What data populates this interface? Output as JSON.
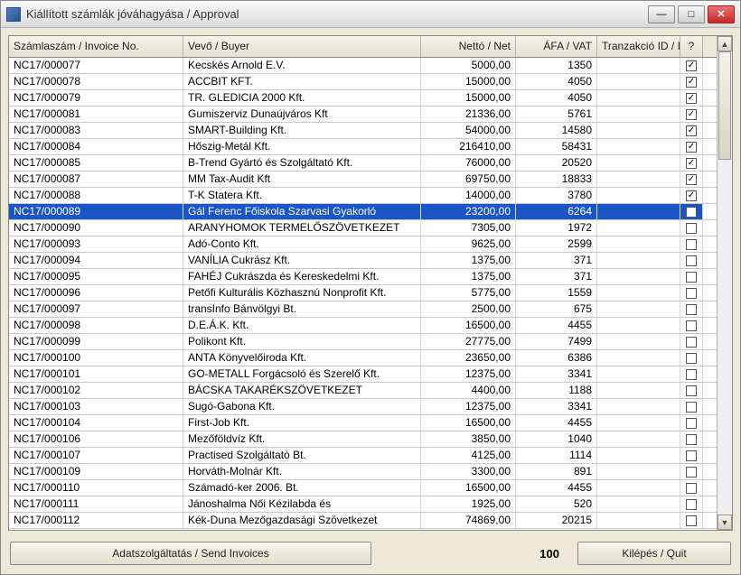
{
  "window": {
    "title": "Kiállított számlák jóváhagyása / Approval"
  },
  "columns": {
    "invoice": "Számlaszám / Invoice No.",
    "buyer": "Vevő / Buyer",
    "net": "Nettó / Net",
    "vat": "ÁFA / VAT",
    "tid": "Tranzakció ID / ID",
    "q": "?"
  },
  "rows": [
    {
      "inv": "NC17/000077",
      "buy": "Kecskés Arnold E.V.",
      "net": "5000,00",
      "vat": "1350",
      "tid": "",
      "chk": true
    },
    {
      "inv": "NC17/000078",
      "buy": "ACCBIT KFT.",
      "net": "15000,00",
      "vat": "4050",
      "tid": "",
      "chk": true
    },
    {
      "inv": "NC17/000079",
      "buy": "TR. GLEDICIA 2000 Kft.",
      "net": "15000,00",
      "vat": "4050",
      "tid": "",
      "chk": true
    },
    {
      "inv": "NC17/000081",
      "buy": "Gumiszerviz Dunaújváros Kft",
      "net": "21336,00",
      "vat": "5761",
      "tid": "",
      "chk": true
    },
    {
      "inv": "NC17/000083",
      "buy": "SMART-Building Kft.",
      "net": "54000,00",
      "vat": "14580",
      "tid": "",
      "chk": true
    },
    {
      "inv": "NC17/000084",
      "buy": "Hőszig-Metál Kft.",
      "net": "216410,00",
      "vat": "58431",
      "tid": "",
      "chk": true
    },
    {
      "inv": "NC17/000085",
      "buy": "B-Trend Gyártó és Szolgáltató Kft.",
      "net": "76000,00",
      "vat": "20520",
      "tid": "",
      "chk": true
    },
    {
      "inv": "NC17/000087",
      "buy": "MM Tax-Audit Kft",
      "net": "69750,00",
      "vat": "18833",
      "tid": "",
      "chk": true
    },
    {
      "inv": "NC17/000088",
      "buy": "T-K Statera Kft.",
      "net": "14000,00",
      "vat": "3780",
      "tid": "",
      "chk": true
    },
    {
      "inv": "NC17/000089",
      "buy": "Gál Ferenc Főiskola Szarvasi Gyakorló",
      "net": "23200,00",
      "vat": "6264",
      "tid": "",
      "chk": false,
      "selected": true
    },
    {
      "inv": "NC17/000090",
      "buy": "ARANYHOMOK TERMELŐSZÖVETKEZET",
      "net": "7305,00",
      "vat": "1972",
      "tid": "",
      "chk": false
    },
    {
      "inv": "NC17/000093",
      "buy": "Adó-Conto Kft.",
      "net": "9625,00",
      "vat": "2599",
      "tid": "",
      "chk": false
    },
    {
      "inv": "NC17/000094",
      "buy": "VANÍLIA Cukrász Kft.",
      "net": "1375,00",
      "vat": "371",
      "tid": "",
      "chk": false
    },
    {
      "inv": "NC17/000095",
      "buy": "FAHÉJ Cukrászda és Kereskedelmi Kft.",
      "net": "1375,00",
      "vat": "371",
      "tid": "",
      "chk": false
    },
    {
      "inv": "NC17/000096",
      "buy": "Petőfi Kulturális Közhasznú Nonprofit Kft.",
      "net": "5775,00",
      "vat": "1559",
      "tid": "",
      "chk": false
    },
    {
      "inv": "NC17/000097",
      "buy": "transInfo Bánvölgyi Bt.",
      "net": "2500,00",
      "vat": "675",
      "tid": "",
      "chk": false
    },
    {
      "inv": "NC17/000098",
      "buy": "D.E.Á.K. Kft.",
      "net": "16500,00",
      "vat": "4455",
      "tid": "",
      "chk": false
    },
    {
      "inv": "NC17/000099",
      "buy": "Polikont Kft.",
      "net": "27775,00",
      "vat": "7499",
      "tid": "",
      "chk": false
    },
    {
      "inv": "NC17/000100",
      "buy": "ANTA Könyvelőiroda Kft.",
      "net": "23650,00",
      "vat": "6386",
      "tid": "",
      "chk": false
    },
    {
      "inv": "NC17/000101",
      "buy": "GO-METALL Forgácsoló és Szerelő Kft.",
      "net": "12375,00",
      "vat": "3341",
      "tid": "",
      "chk": false
    },
    {
      "inv": "NC17/000102",
      "buy": "BÁCSKA TAKARÉKSZÖVETKEZET",
      "net": "4400,00",
      "vat": "1188",
      "tid": "",
      "chk": false
    },
    {
      "inv": "NC17/000103",
      "buy": "Sugó-Gabona Kft.",
      "net": "12375,00",
      "vat": "3341",
      "tid": "",
      "chk": false
    },
    {
      "inv": "NC17/000104",
      "buy": "First-Job Kft.",
      "net": "16500,00",
      "vat": "4455",
      "tid": "",
      "chk": false
    },
    {
      "inv": "NC17/000106",
      "buy": "Mezőföldvíz Kft.",
      "net": "3850,00",
      "vat": "1040",
      "tid": "",
      "chk": false
    },
    {
      "inv": "NC17/000107",
      "buy": "Practised Szolgáltató Bt.",
      "net": "4125,00",
      "vat": "1114",
      "tid": "",
      "chk": false
    },
    {
      "inv": "NC17/000109",
      "buy": "Horváth-Molnár Kft.",
      "net": "3300,00",
      "vat": "891",
      "tid": "",
      "chk": false
    },
    {
      "inv": "NC17/000110",
      "buy": "Számadó-ker 2006. Bt.",
      "net": "16500,00",
      "vat": "4455",
      "tid": "",
      "chk": false
    },
    {
      "inv": "NC17/000111",
      "buy": "Jánoshalma Női Kézilabda és",
      "net": "1925,00",
      "vat": "520",
      "tid": "",
      "chk": false
    },
    {
      "inv": "NC17/000112",
      "buy": "Kék-Duna Mezőgazdasági Szövetkezet",
      "net": "74869,00",
      "vat": "20215",
      "tid": "",
      "chk": false
    }
  ],
  "footer": {
    "send": "Adatszolgáltatás / Send Invoices",
    "count": "100",
    "quit": "Kilépés / Quit"
  }
}
